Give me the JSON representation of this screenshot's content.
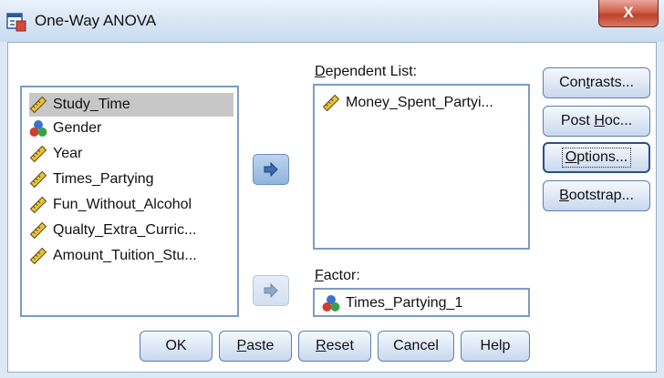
{
  "window": {
    "title": "One-Way ANOVA",
    "close_symbol": "X"
  },
  "variables": {
    "items": [
      {
        "label": "Study_Time",
        "icon": "ruler-icon",
        "selected": true
      },
      {
        "label": "Gender",
        "icon": "nominal-icon",
        "selected": false
      },
      {
        "label": "Year",
        "icon": "ruler-icon",
        "selected": false
      },
      {
        "label": "Times_Partying",
        "icon": "ruler-icon",
        "selected": false
      },
      {
        "label": "Fun_Without_Alcohol",
        "icon": "ruler-icon",
        "selected": false
      },
      {
        "label": "Qualty_Extra_Curric...",
        "icon": "ruler-icon",
        "selected": false
      },
      {
        "label": "Amount_Tuition_Stu...",
        "icon": "ruler-icon",
        "selected": false
      }
    ]
  },
  "dependent": {
    "label_pre": "",
    "label_accel": "D",
    "label_post": "ependent List:",
    "items": [
      {
        "label": "Money_Spent_Partyi...",
        "icon": "ruler-icon"
      }
    ]
  },
  "factor": {
    "label_pre": "",
    "label_accel": "F",
    "label_post": "actor:",
    "value": "Times_Partying_1",
    "icon": "nominal-icon"
  },
  "side_buttons": {
    "contrasts": {
      "pre": "Con",
      "accel": "t",
      "post": "rasts..."
    },
    "post_hoc": {
      "pre": "Post ",
      "accel": "H",
      "post": "oc..."
    },
    "options": {
      "pre": "",
      "accel": "O",
      "post": "ptions..."
    },
    "bootstrap": {
      "pre": "",
      "accel": "B",
      "post": "ootstrap..."
    }
  },
  "bottom_buttons": {
    "ok": {
      "pre": "OK",
      "accel": "",
      "post": ""
    },
    "paste": {
      "pre": "",
      "accel": "P",
      "post": "aste"
    },
    "reset": {
      "pre": "",
      "accel": "R",
      "post": "eset"
    },
    "cancel": {
      "pre": "Cancel",
      "accel": "",
      "post": ""
    },
    "help": {
      "pre": "Help",
      "accel": "",
      "post": ""
    }
  },
  "colors": {
    "accent_blue": "#3b6fb6",
    "selection_gray": "#c7c7c7",
    "close_red": "#c0402a"
  }
}
